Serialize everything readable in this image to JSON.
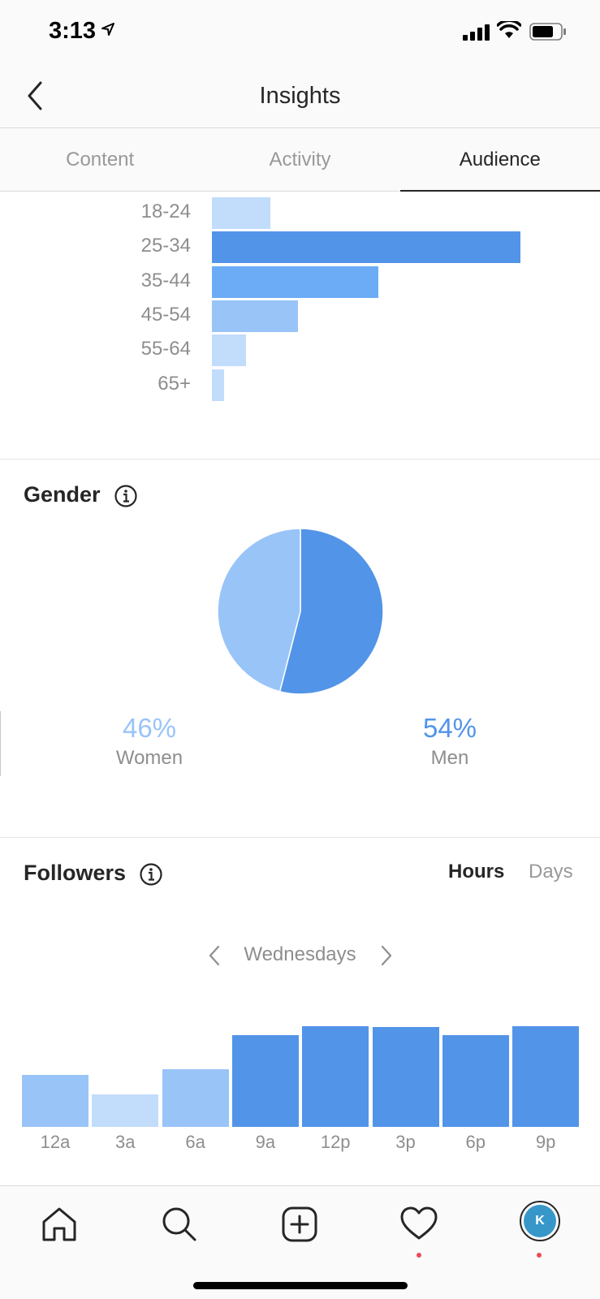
{
  "status_bar": {
    "time": "3:13"
  },
  "header": {
    "title": "Insights"
  },
  "tabs": [
    {
      "label": "Content",
      "active": false
    },
    {
      "label": "Activity",
      "active": false
    },
    {
      "label": "Audience",
      "active": true
    }
  ],
  "age_range": {
    "chart_data": {
      "type": "bar",
      "orientation": "horizontal",
      "categories": [
        "18-24",
        "25-34",
        "35-44",
        "45-54",
        "55-64",
        "65+"
      ],
      "values": [
        19,
        100,
        54,
        28,
        11,
        4
      ],
      "colors": [
        "#c2dcfb",
        "#5294e8",
        "#6cacf6",
        "#99c4f8",
        "#c2dcfb",
        "#c2dcfb"
      ]
    }
  },
  "gender": {
    "title": "Gender",
    "chart_data": {
      "type": "pie",
      "slices": [
        {
          "label": "Women",
          "value": 46,
          "color": "#99c4f8"
        },
        {
          "label": "Men",
          "value": 54,
          "color": "#5294e8"
        }
      ]
    },
    "women": {
      "percent": "46%",
      "label": "Women"
    },
    "men": {
      "percent": "54%",
      "label": "Men"
    }
  },
  "followers": {
    "title": "Followers",
    "toggle": {
      "hours": "Hours",
      "days": "Days",
      "selected": "Hours"
    },
    "day": "Wednesdays",
    "chart_data": {
      "type": "bar",
      "categories": [
        "12a",
        "3a",
        "6a",
        "9a",
        "12p",
        "3p",
        "6p",
        "9p"
      ],
      "values": [
        52,
        32,
        57,
        91,
        100,
        99,
        91,
        100
      ],
      "colors": [
        "#99c4f8",
        "#c2dcfb",
        "#99c4f8",
        "#5294e8",
        "#5294e8",
        "#5294e8",
        "#5294e8",
        "#5294e8"
      ]
    }
  },
  "bottom_nav": {
    "icons": [
      "home-icon",
      "search-icon",
      "new-post-icon",
      "activity-heart-icon",
      "profile-avatar"
    ],
    "avatar_letter": "K",
    "notification_color": "#ed4956"
  }
}
